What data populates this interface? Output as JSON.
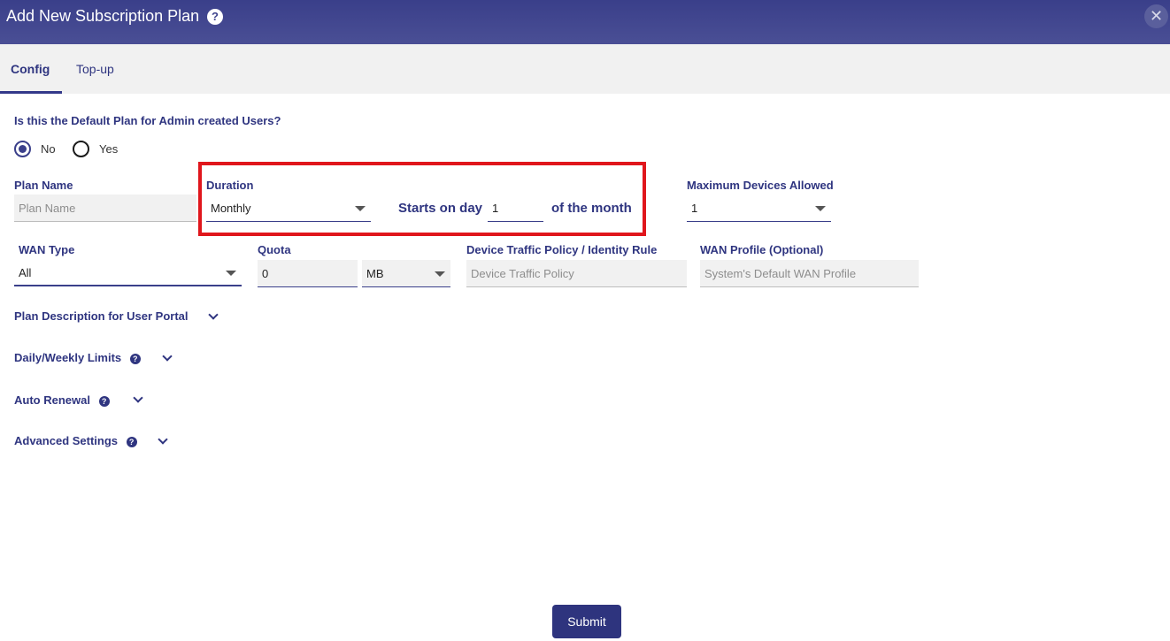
{
  "dialog": {
    "title": "Add New Subscription Plan",
    "help_glyph": "?",
    "close_glyph": "✕"
  },
  "tabs": [
    {
      "label": "Config",
      "active": true
    },
    {
      "label": "Top-up",
      "active": false
    }
  ],
  "default_plan": {
    "question": "Is this the Default Plan for Admin created Users?",
    "options": [
      {
        "label": "No",
        "selected": true
      },
      {
        "label": "Yes",
        "selected": false
      }
    ]
  },
  "plan_name": {
    "label": "Plan Name",
    "placeholder": "Plan Name",
    "value": ""
  },
  "duration": {
    "label": "Duration",
    "selected": "Monthly",
    "starts_on_text": "Starts on day",
    "start_day": "1",
    "suffix_text": "of the month"
  },
  "max_devices": {
    "label": "Maximum Devices Allowed",
    "selected": "1"
  },
  "wan_type": {
    "label": "WAN Type",
    "selected": "All"
  },
  "quota": {
    "label": "Quota",
    "value": "0",
    "unit": "MB"
  },
  "device_traffic": {
    "label": "Device Traffic Policy / Identity Rule",
    "placeholder": "Device Traffic Policy"
  },
  "wan_profile": {
    "label": "WAN Profile (Optional)",
    "placeholder": "System's Default WAN Profile"
  },
  "sections": [
    {
      "label": "Plan Description for User Portal",
      "help": false
    },
    {
      "label": "Daily/Weekly Limits",
      "help": true
    },
    {
      "label": "Auto Renewal",
      "help": true
    },
    {
      "label": "Advanced Settings",
      "help": true
    }
  ],
  "submit_label": "Submit",
  "colors": {
    "primary": "#3a3f8a",
    "highlight": "#e0161c"
  }
}
